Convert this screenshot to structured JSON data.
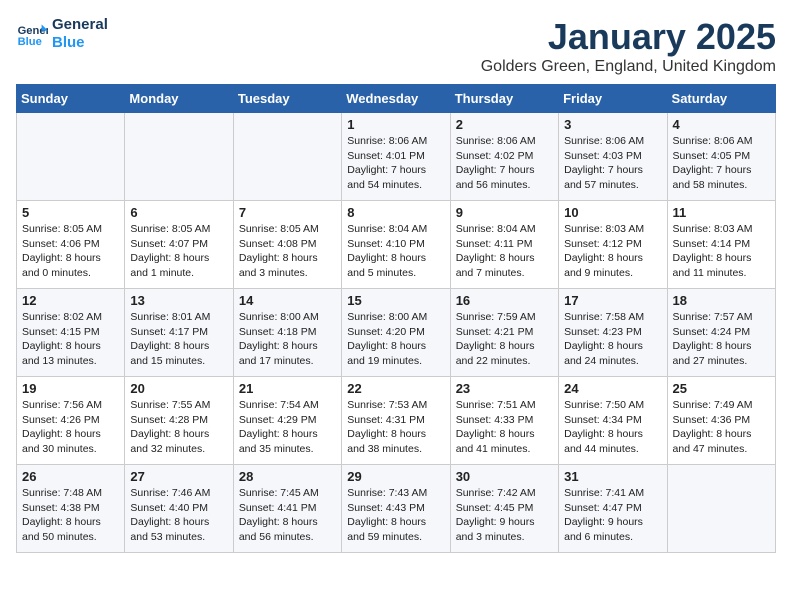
{
  "logo": {
    "line1": "General",
    "line2": "Blue"
  },
  "title": "January 2025",
  "subtitle": "Golders Green, England, United Kingdom",
  "days_of_week": [
    "Sunday",
    "Monday",
    "Tuesday",
    "Wednesday",
    "Thursday",
    "Friday",
    "Saturday"
  ],
  "weeks": [
    [
      {
        "day": "",
        "content": ""
      },
      {
        "day": "",
        "content": ""
      },
      {
        "day": "",
        "content": ""
      },
      {
        "day": "1",
        "content": "Sunrise: 8:06 AM\nSunset: 4:01 PM\nDaylight: 7 hours and 54 minutes."
      },
      {
        "day": "2",
        "content": "Sunrise: 8:06 AM\nSunset: 4:02 PM\nDaylight: 7 hours and 56 minutes."
      },
      {
        "day": "3",
        "content": "Sunrise: 8:06 AM\nSunset: 4:03 PM\nDaylight: 7 hours and 57 minutes."
      },
      {
        "day": "4",
        "content": "Sunrise: 8:06 AM\nSunset: 4:05 PM\nDaylight: 7 hours and 58 minutes."
      }
    ],
    [
      {
        "day": "5",
        "content": "Sunrise: 8:05 AM\nSunset: 4:06 PM\nDaylight: 8 hours and 0 minutes."
      },
      {
        "day": "6",
        "content": "Sunrise: 8:05 AM\nSunset: 4:07 PM\nDaylight: 8 hours and 1 minute."
      },
      {
        "day": "7",
        "content": "Sunrise: 8:05 AM\nSunset: 4:08 PM\nDaylight: 8 hours and 3 minutes."
      },
      {
        "day": "8",
        "content": "Sunrise: 8:04 AM\nSunset: 4:10 PM\nDaylight: 8 hours and 5 minutes."
      },
      {
        "day": "9",
        "content": "Sunrise: 8:04 AM\nSunset: 4:11 PM\nDaylight: 8 hours and 7 minutes."
      },
      {
        "day": "10",
        "content": "Sunrise: 8:03 AM\nSunset: 4:12 PM\nDaylight: 8 hours and 9 minutes."
      },
      {
        "day": "11",
        "content": "Sunrise: 8:03 AM\nSunset: 4:14 PM\nDaylight: 8 hours and 11 minutes."
      }
    ],
    [
      {
        "day": "12",
        "content": "Sunrise: 8:02 AM\nSunset: 4:15 PM\nDaylight: 8 hours and 13 minutes."
      },
      {
        "day": "13",
        "content": "Sunrise: 8:01 AM\nSunset: 4:17 PM\nDaylight: 8 hours and 15 minutes."
      },
      {
        "day": "14",
        "content": "Sunrise: 8:00 AM\nSunset: 4:18 PM\nDaylight: 8 hours and 17 minutes."
      },
      {
        "day": "15",
        "content": "Sunrise: 8:00 AM\nSunset: 4:20 PM\nDaylight: 8 hours and 19 minutes."
      },
      {
        "day": "16",
        "content": "Sunrise: 7:59 AM\nSunset: 4:21 PM\nDaylight: 8 hours and 22 minutes."
      },
      {
        "day": "17",
        "content": "Sunrise: 7:58 AM\nSunset: 4:23 PM\nDaylight: 8 hours and 24 minutes."
      },
      {
        "day": "18",
        "content": "Sunrise: 7:57 AM\nSunset: 4:24 PM\nDaylight: 8 hours and 27 minutes."
      }
    ],
    [
      {
        "day": "19",
        "content": "Sunrise: 7:56 AM\nSunset: 4:26 PM\nDaylight: 8 hours and 30 minutes."
      },
      {
        "day": "20",
        "content": "Sunrise: 7:55 AM\nSunset: 4:28 PM\nDaylight: 8 hours and 32 minutes."
      },
      {
        "day": "21",
        "content": "Sunrise: 7:54 AM\nSunset: 4:29 PM\nDaylight: 8 hours and 35 minutes."
      },
      {
        "day": "22",
        "content": "Sunrise: 7:53 AM\nSunset: 4:31 PM\nDaylight: 8 hours and 38 minutes."
      },
      {
        "day": "23",
        "content": "Sunrise: 7:51 AM\nSunset: 4:33 PM\nDaylight: 8 hours and 41 minutes."
      },
      {
        "day": "24",
        "content": "Sunrise: 7:50 AM\nSunset: 4:34 PM\nDaylight: 8 hours and 44 minutes."
      },
      {
        "day": "25",
        "content": "Sunrise: 7:49 AM\nSunset: 4:36 PM\nDaylight: 8 hours and 47 minutes."
      }
    ],
    [
      {
        "day": "26",
        "content": "Sunrise: 7:48 AM\nSunset: 4:38 PM\nDaylight: 8 hours and 50 minutes."
      },
      {
        "day": "27",
        "content": "Sunrise: 7:46 AM\nSunset: 4:40 PM\nDaylight: 8 hours and 53 minutes."
      },
      {
        "day": "28",
        "content": "Sunrise: 7:45 AM\nSunset: 4:41 PM\nDaylight: 8 hours and 56 minutes."
      },
      {
        "day": "29",
        "content": "Sunrise: 7:43 AM\nSunset: 4:43 PM\nDaylight: 8 hours and 59 minutes."
      },
      {
        "day": "30",
        "content": "Sunrise: 7:42 AM\nSunset: 4:45 PM\nDaylight: 9 hours and 3 minutes."
      },
      {
        "day": "31",
        "content": "Sunrise: 7:41 AM\nSunset: 4:47 PM\nDaylight: 9 hours and 6 minutes."
      },
      {
        "day": "",
        "content": ""
      }
    ]
  ]
}
